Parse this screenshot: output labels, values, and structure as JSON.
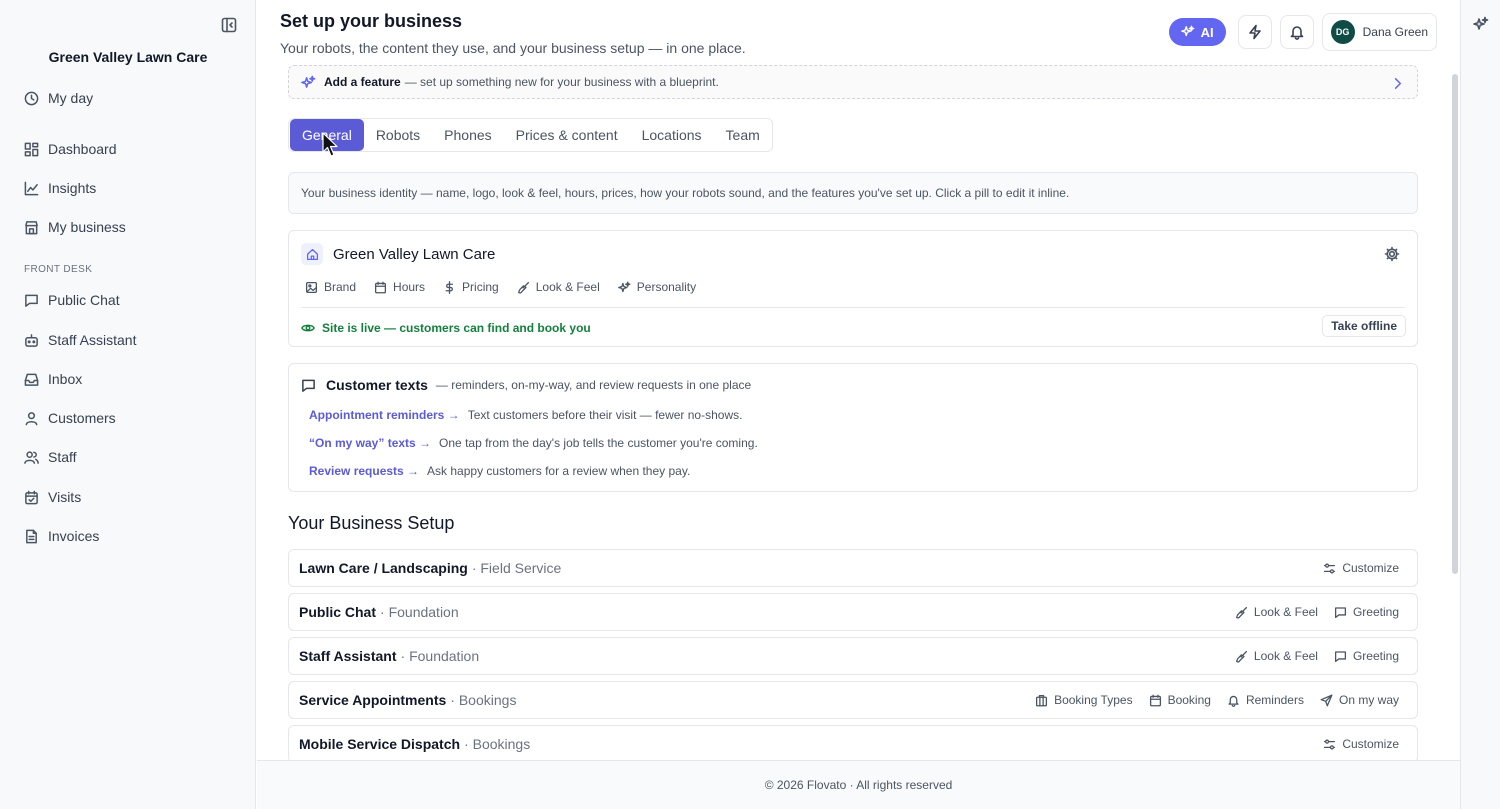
{
  "sidebar": {
    "brand": "Green Valley Lawn Care",
    "top_items": [
      {
        "label": "My day",
        "icon": "clock-icon"
      }
    ],
    "items": [
      {
        "label": "Dashboard",
        "icon": "dashboard-icon"
      },
      {
        "label": "Insights",
        "icon": "chart-line-icon"
      },
      {
        "label": "My business",
        "icon": "store-icon"
      }
    ],
    "section_label": "FRONT DESK",
    "front_desk_items": [
      {
        "label": "Public Chat",
        "icon": "chat-icon"
      },
      {
        "label": "Staff Assistant",
        "icon": "bot-icon"
      },
      {
        "label": "Inbox",
        "icon": "inbox-icon"
      },
      {
        "label": "Customers",
        "icon": "user-icon"
      },
      {
        "label": "Staff",
        "icon": "users-icon"
      },
      {
        "label": "Visits",
        "icon": "calendar-check-icon"
      },
      {
        "label": "Invoices",
        "icon": "file-text-icon"
      }
    ]
  },
  "header": {
    "title": "Set up your business",
    "subtitle": "Your robots, the content they use, and your business setup — in one place.",
    "ai_label": "AI",
    "user_initials": "DG",
    "user_name": "Dana Green"
  },
  "feature_bar": {
    "bold": "Add a feature",
    "text": "— set up something new for your business with a blueprint."
  },
  "tabs": [
    "General",
    "Robots",
    "Phones",
    "Prices & content",
    "Locations",
    "Team"
  ],
  "active_tab": "General",
  "info_text": "Your business identity — name, logo, look & feel, hours, prices, how your robots sound, and the features you've set up. Click a pill to edit it inline.",
  "business_card": {
    "name": "Green Valley Lawn Care",
    "pills": [
      {
        "label": "Brand",
        "icon": "image-icon"
      },
      {
        "label": "Hours",
        "icon": "calendar-icon"
      },
      {
        "label": "Pricing",
        "icon": "dollar-icon"
      },
      {
        "label": "Look & Feel",
        "icon": "brush-icon"
      },
      {
        "label": "Personality",
        "icon": "sparkles-icon"
      }
    ],
    "live_text": "Site is live — customers can find and book you",
    "offline_label": "Take offline",
    "live_color": "#15803d"
  },
  "customer_texts": {
    "title": "Customer texts",
    "subtitle": "— reminders, on-my-way, and review requests in one place",
    "rows": [
      {
        "link": "Appointment reminders →",
        "desc": "Text customers before their visit — fewer no-shows."
      },
      {
        "link": "“On my way” texts →",
        "desc": "One tap from the day's job tells the customer you're coming."
      },
      {
        "link": "Review requests →",
        "desc": "Ask happy customers for a review when they pay."
      }
    ]
  },
  "setup": {
    "title": "Your Business Setup",
    "rows": [
      {
        "name": "Lawn Care / Landscaping",
        "category": "· Field Service",
        "actions": [
          {
            "label": "Customize",
            "icon": "sliders-icon"
          }
        ]
      },
      {
        "name": "Public Chat",
        "category": "· Foundation",
        "actions": [
          {
            "label": "Look & Feel",
            "icon": "brush-icon"
          },
          {
            "label": "Greeting",
            "icon": "chat-icon"
          }
        ]
      },
      {
        "name": "Staff Assistant",
        "category": "· Foundation",
        "actions": [
          {
            "label": "Look & Feel",
            "icon": "brush-icon"
          },
          {
            "label": "Greeting",
            "icon": "chat-icon"
          }
        ]
      },
      {
        "name": "Service Appointments",
        "category": "· Bookings",
        "actions": [
          {
            "label": "Booking Types",
            "icon": "building-icon"
          },
          {
            "label": "Booking",
            "icon": "calendar-icon"
          },
          {
            "label": "Reminders",
            "icon": "bell-icon"
          },
          {
            "label": "On my way",
            "icon": "send-icon"
          }
        ]
      },
      {
        "name": "Mobile Service Dispatch",
        "category": "· Bookings",
        "actions": [
          {
            "label": "Customize",
            "icon": "sliders-icon"
          }
        ]
      }
    ]
  },
  "footer": "© 2026 Flovato · All rights reserved",
  "colors": {
    "accent": "#5b5bd6",
    "ai": "#6366f1",
    "avatar": "#0f4c45"
  }
}
